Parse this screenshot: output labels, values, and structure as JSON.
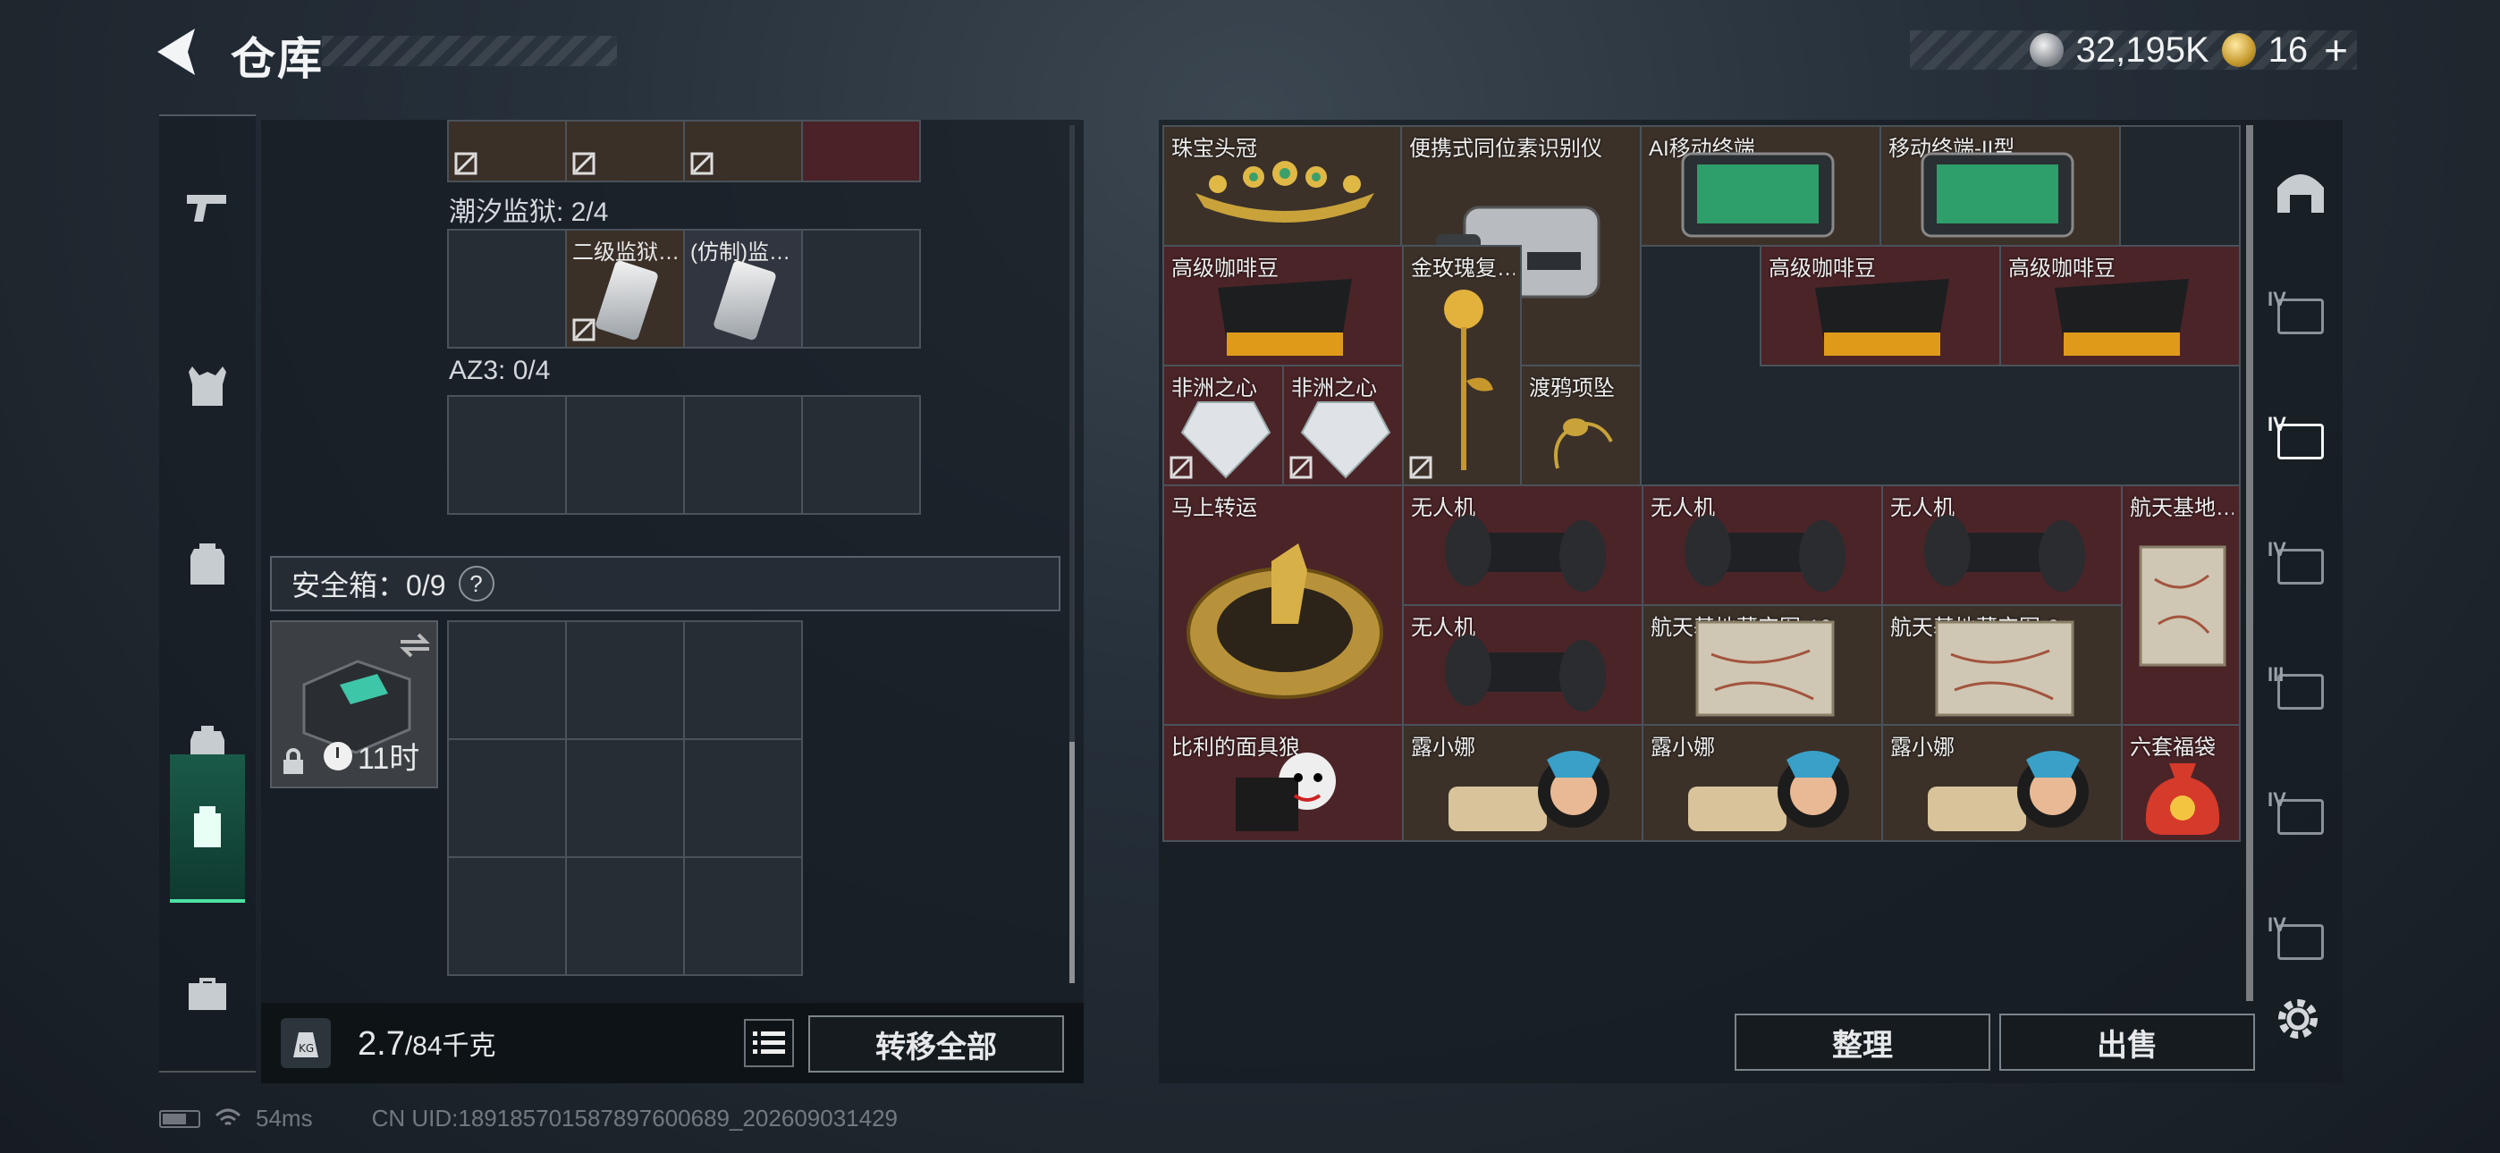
{
  "header": {
    "title": "仓库",
    "currency_silver": "32,195K",
    "currency_gold": "16",
    "plus": "+"
  },
  "left_nav": {
    "items": [
      {
        "icon": "pistol-icon"
      },
      {
        "icon": "vest-icon"
      },
      {
        "icon": "backpack-icon"
      },
      {
        "icon": "pouch-icon"
      },
      {
        "icon": "secure-container-icon",
        "active": true
      },
      {
        "icon": "briefcase-icon"
      }
    ]
  },
  "left_panel": {
    "prison_label": "潮汐监狱: 2/4",
    "prison_cells": [
      "",
      "二级监狱…",
      "(仿制)监…",
      ""
    ],
    "az3_label": "AZ3: 0/4",
    "safe_label": "安全箱：0/9",
    "help": "?",
    "safe_time": "11时",
    "weight_value": "2.7",
    "weight_max": "/84千克",
    "transfer_all": "转移全部"
  },
  "items": [
    {
      "label": "珠宝头冠",
      "color": "brown"
    },
    {
      "label": "便携式同位素识别仪",
      "color": "brown"
    },
    {
      "label": "AI移动终端",
      "color": "brown"
    },
    {
      "label": "移动终端-II型",
      "color": "brown"
    },
    {
      "label": "高级咖啡豆",
      "color": "red"
    },
    {
      "label": "金玫瑰复…",
      "color": "brown"
    },
    {
      "label": "高级咖啡豆",
      "color": "red"
    },
    {
      "label": "高级咖啡豆",
      "color": "red"
    },
    {
      "label": "非洲之心",
      "color": "red"
    },
    {
      "label": "非洲之心",
      "color": "red"
    },
    {
      "label": "渡鸦项坠",
      "color": "brown"
    },
    {
      "label": "马上转运",
      "color": "red"
    },
    {
      "label": "无人机",
      "color": "red"
    },
    {
      "label": "无人机",
      "color": "red"
    },
    {
      "label": "无人机",
      "color": "red"
    },
    {
      "label": "航天基地…",
      "color": "red"
    },
    {
      "label": "无人机",
      "color": "red"
    },
    {
      "label": "航天基地藏宝图-10",
      "color": "brown"
    },
    {
      "label": "航天基地藏宝图-9",
      "color": "brown"
    },
    {
      "label": "比利的面具狼",
      "color": "red"
    },
    {
      "label": "露小娜",
      "color": "brown"
    },
    {
      "label": "露小娜",
      "color": "brown"
    },
    {
      "label": "露小娜",
      "color": "brown"
    },
    {
      "label": "六套福袋",
      "color": "red"
    }
  ],
  "buttons": {
    "sort": "整理",
    "sell": "出售"
  },
  "right_nav": {
    "items": [
      {
        "tier": "",
        "icon": "shelter-icon"
      },
      {
        "tier": "IV",
        "icon": "folder-icon"
      },
      {
        "tier": "IV",
        "icon": "camera-icon",
        "active": true
      },
      {
        "tier": "IV",
        "icon": "camera-icon"
      },
      {
        "tier": "III",
        "icon": "grip-icon"
      },
      {
        "tier": "IV",
        "icon": "gun-part-icon"
      },
      {
        "tier": "IV",
        "icon": "gun-part-icon"
      }
    ]
  },
  "status": {
    "ping": "54ms",
    "uid": "CN UID:1891857015878976006​89_202609031429"
  },
  "colors": {
    "accent": "#4de0a5",
    "item_red": "#4b2428",
    "item_brown": "#3b3129"
  }
}
